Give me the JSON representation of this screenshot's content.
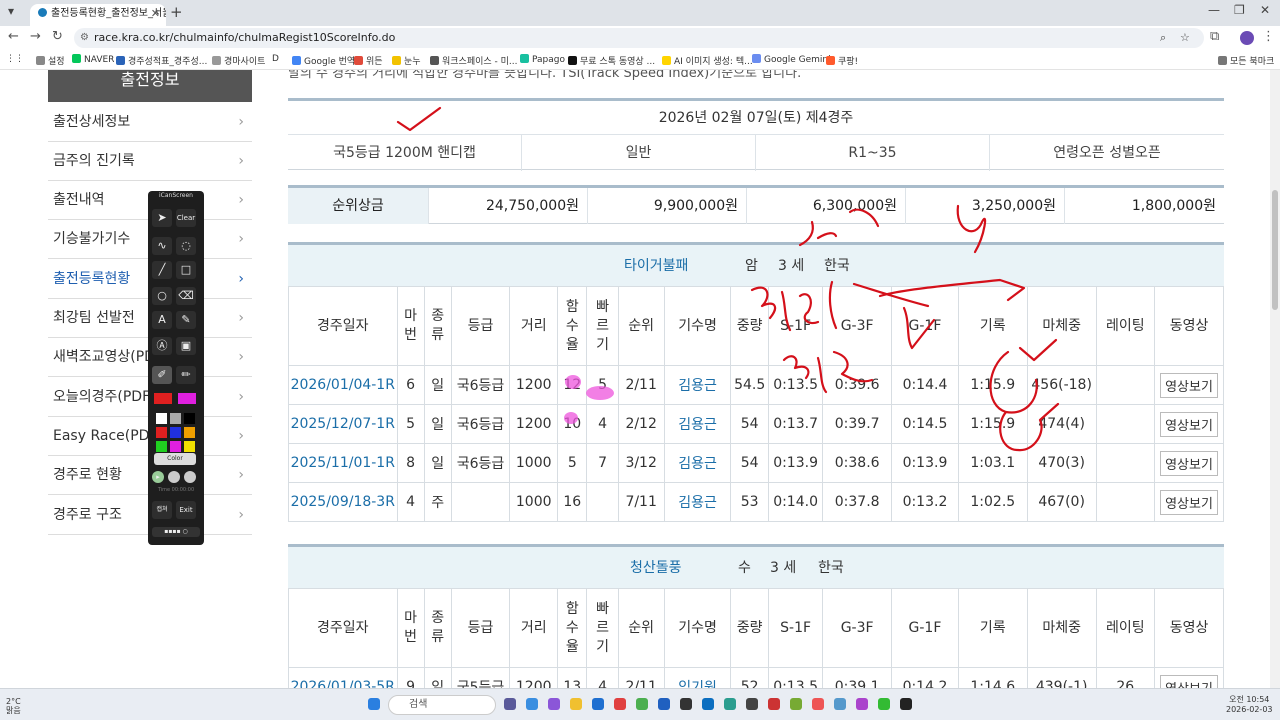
{
  "browser": {
    "tab_title": "출전등록현황_출전정보_서울경",
    "url": "race.kra.co.kr/chulmainfo/chulmaRegist10ScoreInfo.do",
    "profile": "NNN"
  },
  "bookmarks": [
    "설정",
    "NAVER",
    "경주성적표_경주성...",
    "경마사이트",
    "D",
    "Google 번역",
    "위든",
    "눈누",
    "워크스페이스 - 미...",
    "Papago",
    "무료 스톡 동영상 ...",
    "AI 이미지 생성: 텍...",
    "Google Gemini",
    "쿠팡!",
    "모든 북마크"
  ],
  "sidebar": {
    "header": "출전정보",
    "items": [
      {
        "label": "출전상세정보"
      },
      {
        "label": "금주의 진기록"
      },
      {
        "label": "출전내역"
      },
      {
        "label": "기승불가기수"
      },
      {
        "label": "출전등록현황",
        "active": true
      },
      {
        "label": "최강팀 선발전"
      },
      {
        "label": "새벽조교영상(PDF)"
      },
      {
        "label": "오늘의경주(PDF)"
      },
      {
        "label": "Easy Race(PDF)"
      },
      {
        "label": "경주로 현황"
      },
      {
        "label": "경주로 구조"
      }
    ]
  },
  "top_note": "말의 수 경주의 거리에 적합한 경주마를 뜻합니다. TSI(Track Speed Index)기준으로 합니다.",
  "race": {
    "header": "2026년 02월 07일(토) 제4경주",
    "conditions": [
      "국5등급 1200M 핸디캡",
      "일반",
      "R1~35",
      "연령오픈 성별오픈"
    ],
    "prize_label": "순위상금",
    "prizes": [
      "24,750,000원",
      "9,900,000원",
      "6,300,000원",
      "3,250,000원",
      "1,800,000원"
    ]
  },
  "columns": [
    "경주일자",
    "마번",
    "종류",
    "등급",
    "거리",
    "함수율",
    "빠르기",
    "순위",
    "기수명",
    "중량",
    "S-1F",
    "G-3F",
    "G-1F",
    "기록",
    "마체중",
    "레이팅",
    "동영상"
  ],
  "horses": [
    {
      "name": "타이거불패",
      "sex": "암",
      "age": "3 세",
      "origin": "한국",
      "rows": [
        [
          "2026/01/04-1R",
          "6",
          "일",
          "국6등급",
          "1200",
          "12",
          "5",
          "2/11",
          "김용근",
          "54.5",
          "0:13.5",
          "0:39.6",
          "0:14.4",
          "1:15.9",
          "456(-18)",
          "",
          "영상보기"
        ],
        [
          "2025/12/07-1R",
          "5",
          "일",
          "국6등급",
          "1200",
          "10",
          "4",
          "2/12",
          "김용근",
          "54",
          "0:13.7",
          "0:39.7",
          "0:14.5",
          "1:15.9",
          "474(4)",
          "",
          "영상보기"
        ],
        [
          "2025/11/01-1R",
          "8",
          "일",
          "국6등급",
          "1000",
          "5",
          "7",
          "3/12",
          "김용근",
          "54",
          "0:13.9",
          "0:38.6",
          "0:13.9",
          "1:03.1",
          "470(3)",
          "",
          "영상보기"
        ],
        [
          "2025/09/18-3R",
          "4",
          "주",
          "",
          "1000",
          "16",
          "",
          "7/11",
          "김용근",
          "53",
          "0:14.0",
          "0:37.8",
          "0:13.2",
          "1:02.5",
          "467(0)",
          "",
          "영상보기"
        ]
      ]
    },
    {
      "name": "청산돌풍",
      "sex": "수",
      "age": "3 세",
      "origin": "한국",
      "rows": [
        [
          "2026/01/03-5R",
          "9",
          "일",
          "국5등급",
          "1200",
          "13",
          "4",
          "2/11",
          "임기원",
          "52",
          "0:13.5",
          "0:39.1",
          "0:14.2",
          "1:14.6",
          "439(-1)",
          "26",
          "영상보기"
        ]
      ]
    }
  ],
  "icanscreen": {
    "title": "iCanScreen",
    "clear": "Clear",
    "color": "Color",
    "time": "Time 00:00:00",
    "capture": "캡쳐",
    "exit": "Exit"
  },
  "taskbar": {
    "weather_temp": "2°C",
    "weather_text": "맑음",
    "search": "검색",
    "time": "오전 10:54",
    "date": "2026-02-03"
  },
  "colors": {
    "link": "#1b6ea8",
    "header_bg": "#e9f3f7",
    "ink": "#d4101a",
    "highlight": "#ee55dd"
  }
}
